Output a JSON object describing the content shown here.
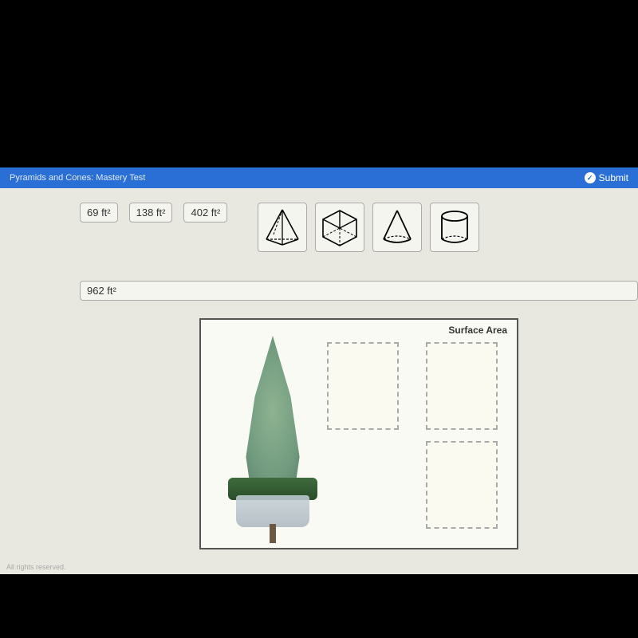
{
  "header": {
    "title": "Pyramids and Cones: Mastery Test",
    "submit_label": "Submit"
  },
  "answer_values": {
    "v1": "69 ft²",
    "v2": "138 ft²",
    "v3": "402 ft²",
    "v4": "962 ft²"
  },
  "shapes": {
    "pyramid": "square-pyramid-icon",
    "cube": "cube-icon",
    "cone": "cone-icon",
    "cylinder": "cylinder-icon"
  },
  "answer_box": {
    "label": "Surface Area"
  },
  "footer": {
    "copyright": "All rights reserved."
  }
}
